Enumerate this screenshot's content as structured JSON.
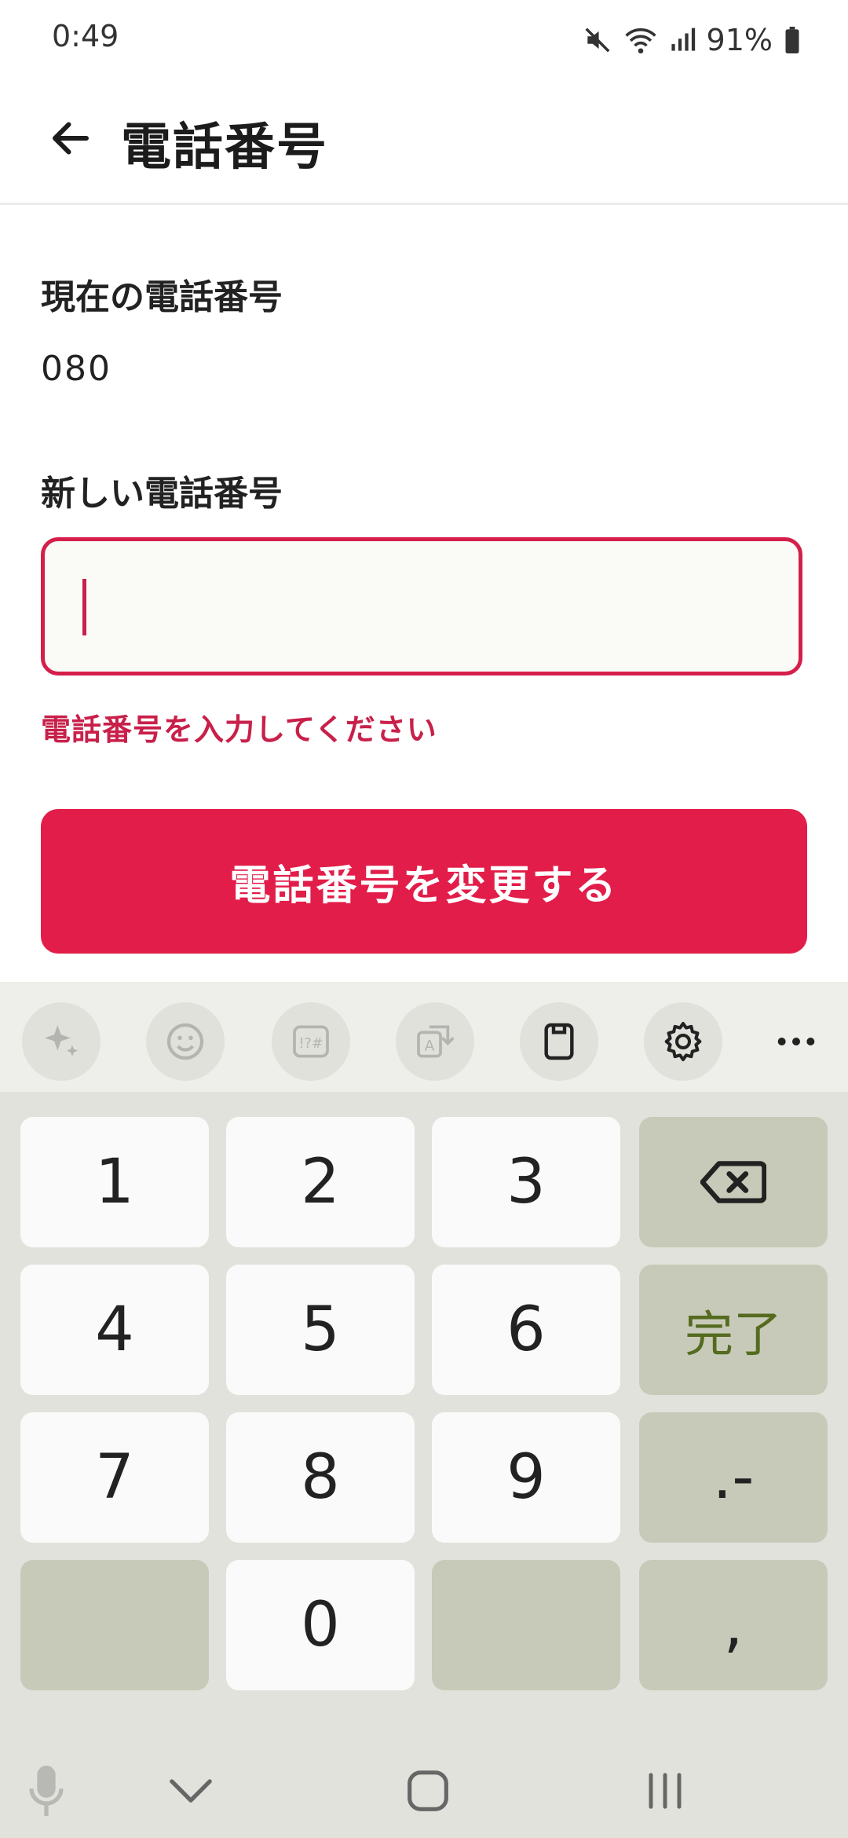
{
  "status": {
    "time": "0:49",
    "battery": "91%"
  },
  "header": {
    "title": "電話番号"
  },
  "form": {
    "current_label": "現在の電話番号",
    "current_value": "080",
    "new_label": "新しい電話番号",
    "new_value": "",
    "error": "電話番号を入力してください",
    "submit_label": "電話番号を変更する"
  },
  "keyboard": {
    "toolbar": [
      "ai-sparkle-icon",
      "emoji-icon",
      "symbols-icon",
      "translate-icon",
      "clipboard-icon",
      "settings-icon",
      "more-icon"
    ],
    "keys": {
      "k1": "1",
      "k2": "2",
      "k3": "3",
      "k4": "4",
      "k5": "5",
      "k6": "6",
      "k7": "7",
      "k8": "8",
      "k9": "9",
      "k0": "0",
      "done": "完了",
      "dot_dash": ".-",
      "comma": ","
    }
  },
  "colors": {
    "accent": "#e21d49",
    "error": "#c8204a",
    "key_func": "#c8cab9",
    "done_text": "#556b1f"
  }
}
